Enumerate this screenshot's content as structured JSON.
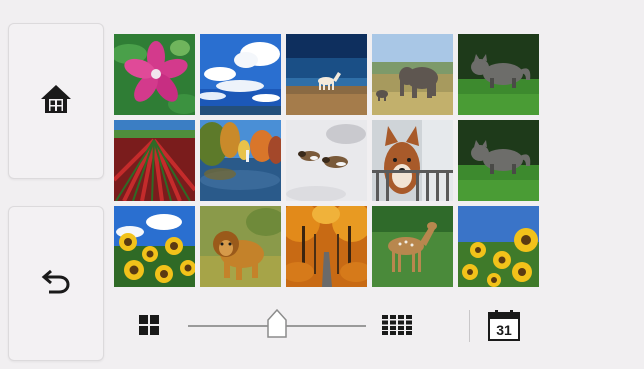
{
  "sidebar": {
    "home_icon": "home-icon",
    "back_icon": "back-arrow-icon"
  },
  "photo_grid": {
    "columns": 5,
    "rows": 3,
    "photos": [
      {
        "subject": "pink-flower"
      },
      {
        "subject": "blue-sky-clouds"
      },
      {
        "subject": "horse-on-beach"
      },
      {
        "subject": "elephant"
      },
      {
        "subject": "cat-on-grass"
      },
      {
        "subject": "tulip-field"
      },
      {
        "subject": "autumn-lake"
      },
      {
        "subject": "dogs-in-snow"
      },
      {
        "subject": "shiba-dog"
      },
      {
        "subject": "cat-on-grass"
      },
      {
        "subject": "sunflowers-sky"
      },
      {
        "subject": "lion"
      },
      {
        "subject": "autumn-road"
      },
      {
        "subject": "deer"
      },
      {
        "subject": "sunflower-field"
      }
    ]
  },
  "toolbar": {
    "view_small_icon": "grid-2x2-icon",
    "view_large_icon": "grid-4x4-icon",
    "zoom_level": 0.5,
    "calendar_icon": "calendar-icon",
    "calendar_day": "31"
  },
  "colors": {
    "background": "#f1eff1",
    "icon_dark": "#1a1a1a"
  }
}
